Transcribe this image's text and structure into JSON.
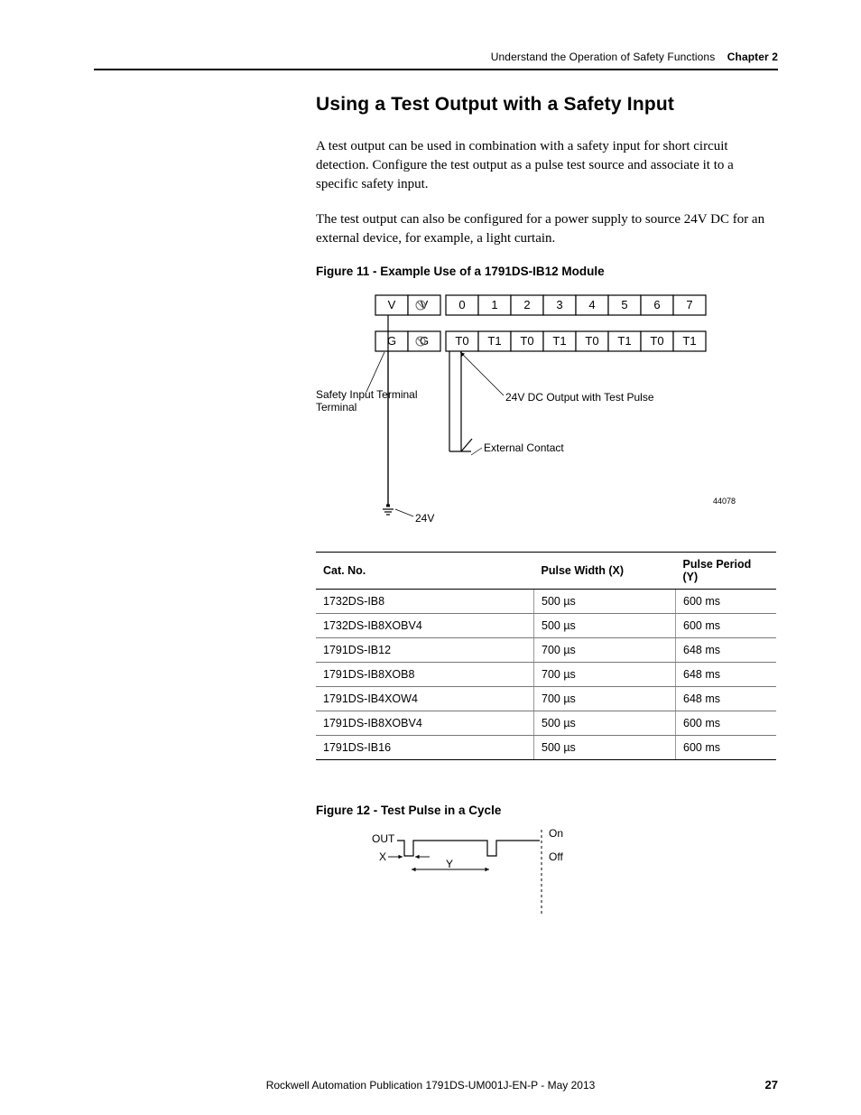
{
  "header": {
    "running_title": "Understand the Operation of Safety Functions",
    "chapter_label": "Chapter 2"
  },
  "section": {
    "title": "Using a Test Output with a Safety Input",
    "para1": "A test output can be used in combination with a safety input for short circuit detection. Configure the test output as a pulse test source and associate it to a specific safety input.",
    "para2": "The test output can also be configured for a power supply to source 24V DC for an external device, for example, a light curtain."
  },
  "figure11": {
    "caption": "Figure 11 - Example Use of a 1791DS-IB12 Module",
    "row1": [
      "V",
      "V",
      "0",
      "1",
      "2",
      "3",
      "4",
      "5",
      "6",
      "7"
    ],
    "row2": [
      "G",
      "G",
      "T0",
      "T1",
      "T0",
      "T1",
      "T0",
      "T1",
      "T0",
      "T1"
    ],
    "label_safety": "Safety Input Terminal",
    "label_24vdc": "24V DC Output with Test Pulse",
    "label_ext": "External Contact",
    "label_24v": "24V",
    "docid": "44078"
  },
  "table": {
    "headers": [
      "Cat. No.",
      "Pulse Width (X)",
      "Pulse Period (Y)"
    ],
    "rows": [
      [
        "1732DS-IB8",
        "500 µs",
        "600 ms"
      ],
      [
        "1732DS-IB8XOBV4",
        "500 µs",
        "600 ms"
      ],
      [
        "1791DS-IB12",
        "700 µs",
        "648 ms"
      ],
      [
        "1791DS-IB8XOB8",
        "700 µs",
        "648 ms"
      ],
      [
        "1791DS-IB4XOW4",
        "700 µs",
        "648 ms"
      ],
      [
        "1791DS-IB8XOBV4",
        "500 µs",
        "600 ms"
      ],
      [
        "1791DS-IB16",
        "500 µs",
        "600 ms"
      ]
    ]
  },
  "figure12": {
    "caption": "Figure 12 -  Test Pulse in a Cycle",
    "out": "OUT",
    "x": "X",
    "y": "Y",
    "on": "On",
    "off": "Off"
  },
  "footer": {
    "publication": "Rockwell Automation Publication 1791DS-UM001J-EN-P - May 2013",
    "page": "27"
  }
}
